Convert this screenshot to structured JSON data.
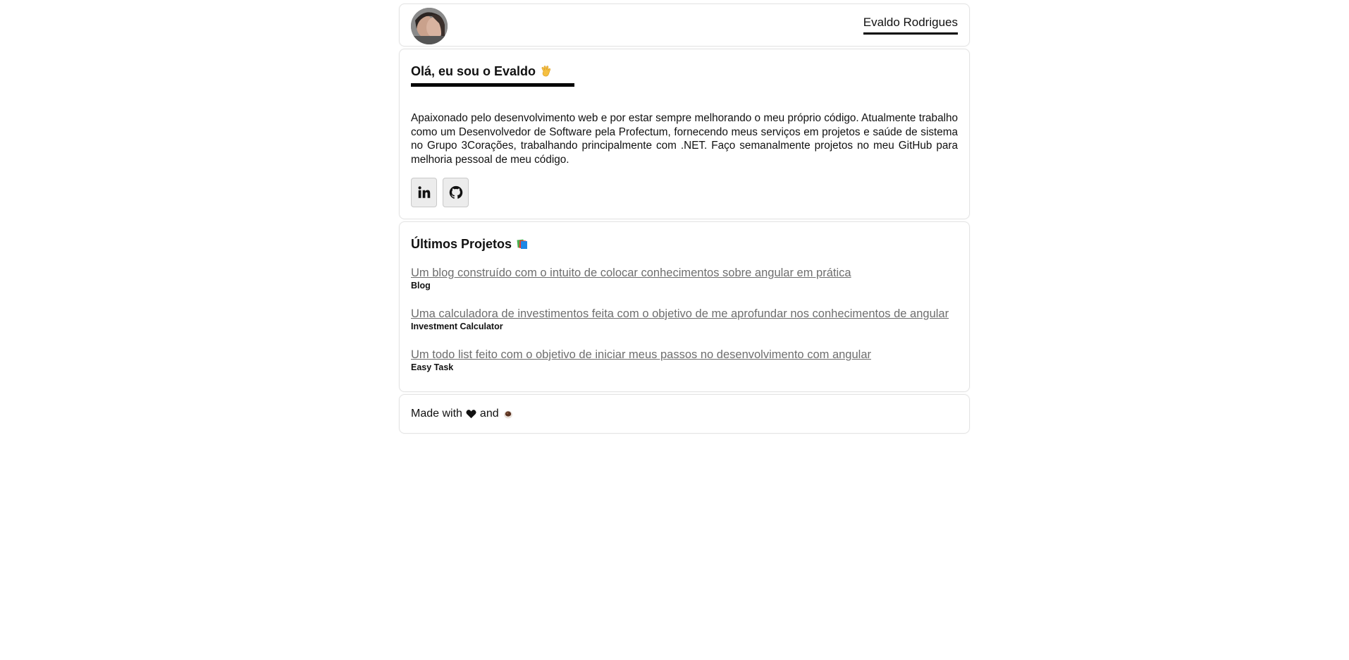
{
  "header": {
    "name": "Evaldo Rodrigues",
    "avatar_alt": "avatar"
  },
  "about": {
    "title": "Olá, eu sou o Evaldo",
    "title_emoji": "waving-hand-icon",
    "text": "Apaixonado pelo desenvolvimento web e por estar sempre melhorando o meu próprio código. Atualmente trabalho como um Desenvolvedor de Software pela Profectum, fornecendo meus serviços em projetos e saúde de sistema no Grupo 3Corações, trabalhando principalmente com .NET. Faço semanalmente projetos no meu GitHub para melhoria pessoal de meu código.",
    "socials": [
      {
        "icon": "linkedin-icon"
      },
      {
        "icon": "github-icon"
      }
    ]
  },
  "projects": {
    "title": "Últimos Projetos",
    "title_emoji": "books-icon",
    "items": [
      {
        "description": "Um blog construído com o intuito de colocar conhecimentos sobre angular em prática",
        "name": "Blog"
      },
      {
        "description": "Uma calculadora de investimentos feita com o objetivo de me aprofundar nos conhecimentos de angular",
        "name": "Investment Calculator"
      },
      {
        "description": "Um todo list feito com o objetivo de iniciar meus passos no desenvolvimento com angular",
        "name": "Easy Task"
      }
    ]
  },
  "footer": {
    "made_with": "Made with",
    "heart": "heart-icon",
    "and": "and",
    "coffee": "coffee-icon"
  },
  "colors": {
    "link": "#6e6e6e",
    "underline": "#000000",
    "border": "#e4e4e4",
    "social_bg": "#ececec"
  }
}
